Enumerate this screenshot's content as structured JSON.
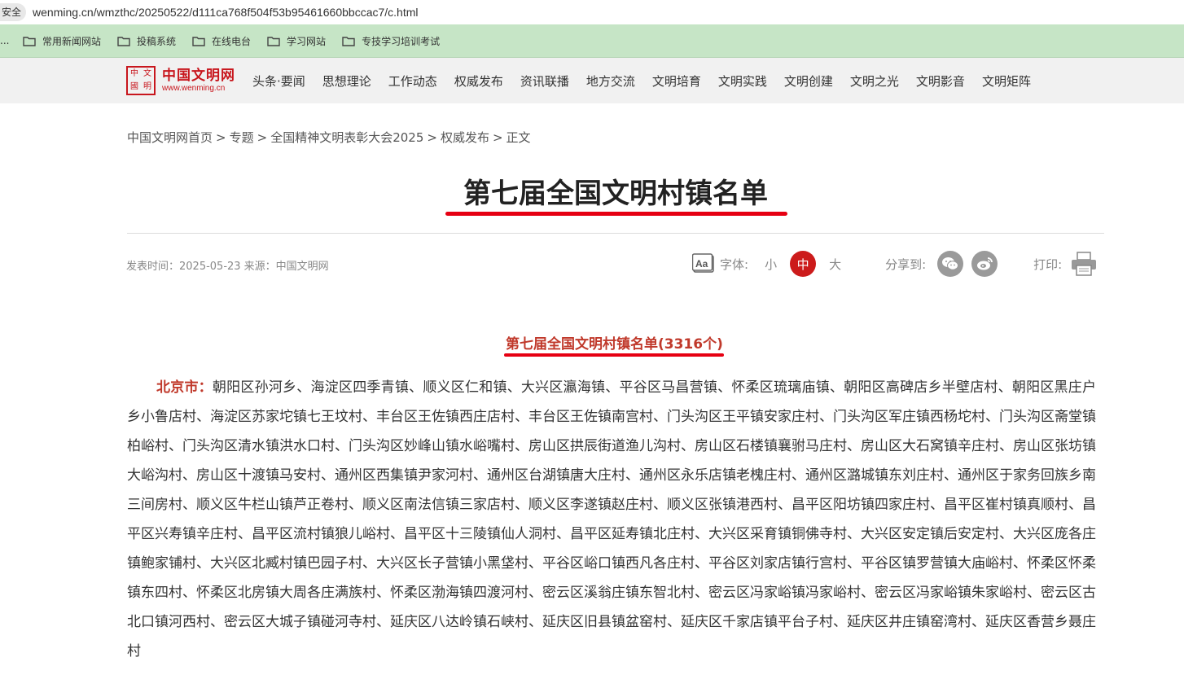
{
  "browser": {
    "secure_label": "安全",
    "url": "wenming.cn/wmzthc/20250522/d111ca768f504f53b95461660bbccac7/c.html"
  },
  "bookmarks": {
    "overflow": "...",
    "items": [
      {
        "label": "常用新闻网站"
      },
      {
        "label": "投稿系统"
      },
      {
        "label": "在线电台"
      },
      {
        "label": "学习网站"
      },
      {
        "label": "专技学习培训考试"
      }
    ]
  },
  "site": {
    "logo_seal_chars": [
      "中",
      "文",
      "國",
      "明"
    ],
    "logo_cn": "中国文明网",
    "logo_en": "www.wenming.cn",
    "brand_color": "#c8161d"
  },
  "nav": {
    "items": [
      {
        "label": "头条·要闻"
      },
      {
        "label": "思想理论"
      },
      {
        "label": "工作动态"
      },
      {
        "label": "权威发布"
      },
      {
        "label": "资讯联播"
      },
      {
        "label": "地方交流"
      },
      {
        "label": "文明培育"
      },
      {
        "label": "文明实践"
      },
      {
        "label": "文明创建"
      },
      {
        "label": "文明之光"
      },
      {
        "label": "文明影音"
      },
      {
        "label": "文明矩阵"
      }
    ]
  },
  "breadcrumb": {
    "items": [
      "中国文明网首页",
      "专题",
      "全国精神文明表彰大会2025",
      "权威发布",
      "正文"
    ],
    "separator": ">"
  },
  "article": {
    "title": "第七届全国文明村镇名单",
    "meta": "发表时间：2025-05-23 来源：中国文明网",
    "subtitle": "第七届全国文明村镇名单(3316个)",
    "region_label": "北京市：",
    "body": "朝阳区孙河乡、海淀区四季青镇、顺义区仁和镇、大兴区瀛海镇、平谷区马昌营镇、怀柔区琉璃庙镇、朝阳区高碑店乡半壁店村、朝阳区黑庄户乡小鲁店村、海淀区苏家坨镇七王坟村、丰台区王佐镇西庄店村、丰台区王佐镇南宫村、门头沟区王平镇安家庄村、门头沟区军庄镇西杨坨村、门头沟区斋堂镇柏峪村、门头沟区清水镇洪水口村、门头沟区妙峰山镇水峪嘴村、房山区拱辰街道渔儿沟村、房山区石楼镇襄驸马庄村、房山区大石窝镇辛庄村、房山区张坊镇大峪沟村、房山区十渡镇马安村、通州区西集镇尹家河村、通州区台湖镇唐大庄村、通州区永乐店镇老槐庄村、通州区潞城镇东刘庄村、通州区于家务回族乡南三间房村、顺义区牛栏山镇芦正卷村、顺义区南法信镇三家店村、顺义区李遂镇赵庄村、顺义区张镇港西村、昌平区阳坊镇四家庄村、昌平区崔村镇真顺村、昌平区兴寿镇辛庄村、昌平区流村镇狼儿峪村、昌平区十三陵镇仙人洞村、昌平区延寿镇北庄村、大兴区采育镇铜佛寺村、大兴区安定镇后安定村、大兴区庞各庄镇鲍家铺村、大兴区北臧村镇巴园子村、大兴区长子营镇小黑垡村、平谷区峪口镇西凡各庄村、平谷区刘家店镇行宫村、平谷区镇罗营镇大庙峪村、怀柔区怀柔镇东四村、怀柔区北房镇大周各庄满族村、怀柔区渤海镇四渡河村、密云区溪翁庄镇东智北村、密云区冯家峪镇冯家峪村、密云区冯家峪镇朱家峪村、密云区古北口镇河西村、密云区大城子镇碰河寺村、延庆区八达岭镇石峡村、延庆区旧县镇盆窑村、延庆区千家店镇平台子村、延庆区井庄镇窑湾村、延庆区香营乡聂庄村"
  },
  "tools": {
    "font_label": "字体:",
    "font_small": "小",
    "font_medium": "中",
    "font_large": "大",
    "share_label": "分享到:",
    "print_label": "打印:",
    "accent_color": "#cc1b1b"
  }
}
